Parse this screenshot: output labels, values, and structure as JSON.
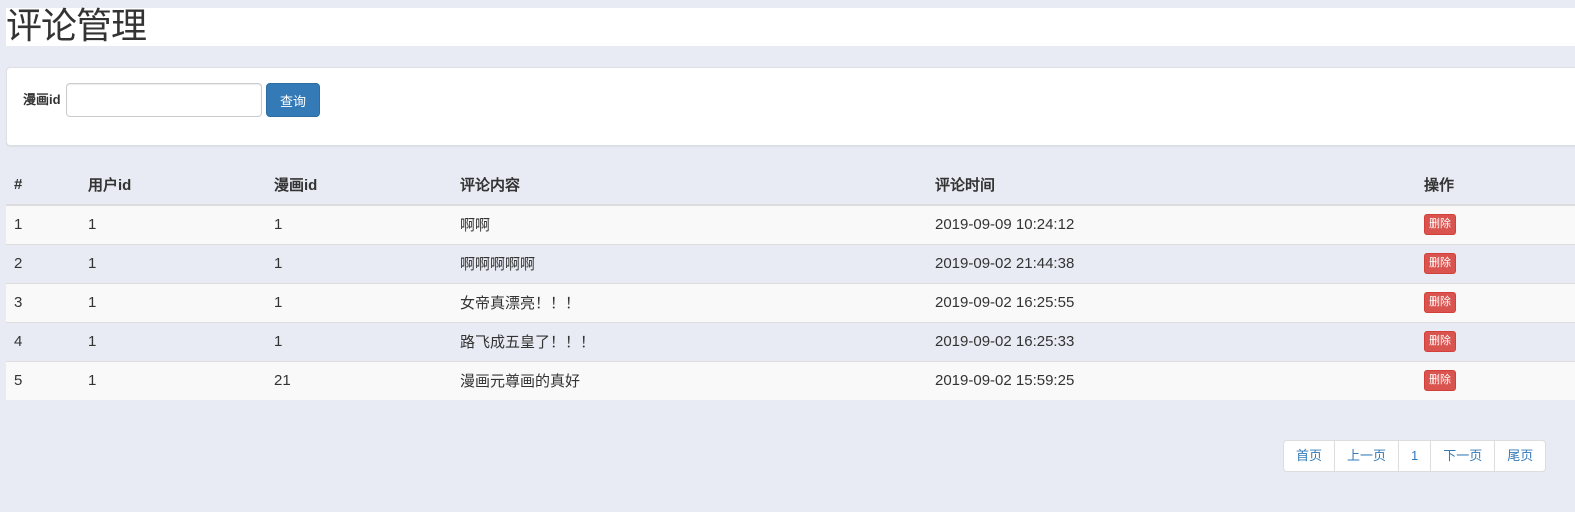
{
  "page": {
    "title": "评论管理"
  },
  "search": {
    "label": "漫画id",
    "value": "",
    "placeholder": "",
    "button_label": "查询"
  },
  "table": {
    "headers": [
      "#",
      "用户id",
      "漫画id",
      "评论内容",
      "评论时间",
      "操作"
    ],
    "rows": [
      {
        "index": "1",
        "user_id": "1",
        "comic_id": "1",
        "content": "啊啊",
        "time": "2019-09-09 10:24:12",
        "action": "删除"
      },
      {
        "index": "2",
        "user_id": "1",
        "comic_id": "1",
        "content": "啊啊啊啊啊",
        "time": "2019-09-02 21:44:38",
        "action": "删除"
      },
      {
        "index": "3",
        "user_id": "1",
        "comic_id": "1",
        "content": "女帝真漂亮！！！",
        "time": "2019-09-02 16:25:55",
        "action": "删除"
      },
      {
        "index": "4",
        "user_id": "1",
        "comic_id": "1",
        "content": "路飞成五皇了！！！",
        "time": "2019-09-02 16:25:33",
        "action": "删除"
      },
      {
        "index": "5",
        "user_id": "1",
        "comic_id": "21",
        "content": "漫画元尊画的真好",
        "time": "2019-09-02 15:59:25",
        "action": "删除"
      }
    ]
  },
  "pagination": {
    "first": "首页",
    "prev": "上一页",
    "current": "1",
    "next": "下一页",
    "last": "尾页"
  },
  "colors": {
    "background": "#e8ebf3",
    "primary": "#337ab7",
    "danger": "#d9534f"
  }
}
